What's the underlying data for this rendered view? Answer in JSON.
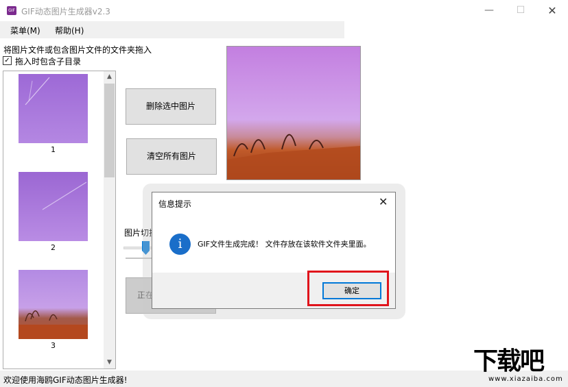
{
  "window": {
    "title": "GIF动态图片生成器v2.3",
    "app_icon_text": "GIF",
    "min_glyph": "—",
    "max_glyph": "☐",
    "close_glyph": "✕"
  },
  "menubar": {
    "items": [
      "菜单(M)",
      "帮助(H)"
    ]
  },
  "drop_hint": "将图片文件或包含图片文件的文件夹拖入",
  "include_subdirs": {
    "label": "拖入时包含子目录",
    "checked": true,
    "check_glyph": "✓"
  },
  "thumbnails": [
    {
      "label": "1",
      "icon": "sky-contrail-thumbnail"
    },
    {
      "label": "2",
      "icon": "sky-contrail-thumbnail"
    },
    {
      "label": "3",
      "icon": "sunset-trees-thumbnail"
    }
  ],
  "scroll": {
    "up_glyph": "▲",
    "down_glyph": "▼"
  },
  "buttons": {
    "delete_selected": "删除选中图片",
    "clear_all": "清空所有图片",
    "generate_partial": "正在"
  },
  "slider": {
    "label_partial": "图片切换"
  },
  "statusbar": {
    "text": "欢迎使用海鸥GIF动态图片生成器!"
  },
  "watermark": {
    "main": "下载吧",
    "sub": "www.xiazaiba.com"
  },
  "dialog": {
    "title": "信息提示",
    "close_glyph": "✕",
    "info_glyph": "i",
    "message": "GIF文件生成完成！ 文件存放在该软件文件夹里面。",
    "ok_label": "确定"
  },
  "colors": {
    "accent": "#0078d7",
    "highlight": "#e0131b",
    "info": "#1a6ec9"
  }
}
